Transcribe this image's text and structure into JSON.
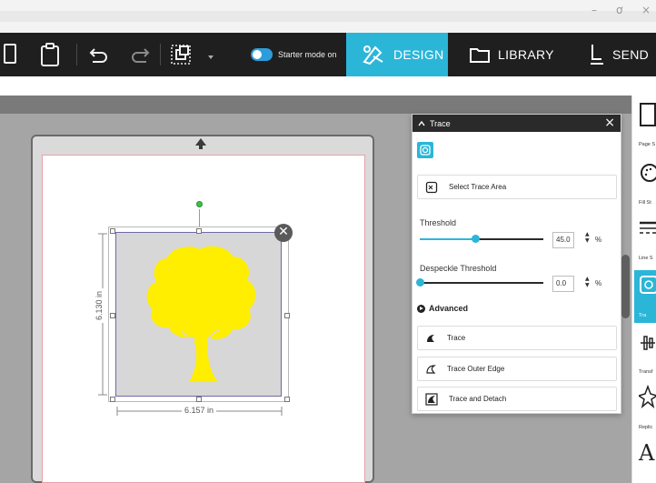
{
  "window": {
    "minimize": "–",
    "restore": "ơ",
    "close": "×"
  },
  "toolbar": {
    "starter_mode_label": "Starter mode on",
    "tabs": [
      {
        "label": "DESIGN",
        "active": true
      },
      {
        "label": "LIBRARY",
        "active": false
      },
      {
        "label": "SEND",
        "active": false
      }
    ]
  },
  "design": {
    "width_label": "6.157 in",
    "height_label": "6.130 in",
    "fill_color": "#ffee00"
  },
  "trace_panel": {
    "title": "Trace",
    "close_glyph": "×",
    "select_trace_area": "Select Trace Area",
    "threshold_label": "Threshold",
    "threshold_value": "45.0",
    "threshold_unit": "%",
    "threshold_fraction": 0.45,
    "despeckle_label": "Despeckle Threshold",
    "despeckle_value": "0.0",
    "despeckle_unit": "%",
    "despeckle_fraction": 0.0,
    "advanced_label": "Advanced",
    "actions": [
      "Trace",
      "Trace Outer Edge",
      "Trace and Detach"
    ]
  },
  "right_tools": {
    "labels": [
      "Page S",
      "Fill St",
      "Line S",
      "Tra",
      "Transf",
      "Replic"
    ],
    "text_tool_glyph": "A"
  },
  "colors": {
    "accent": "#2bb6d8",
    "toolbar_bg": "#1f1f1f"
  }
}
